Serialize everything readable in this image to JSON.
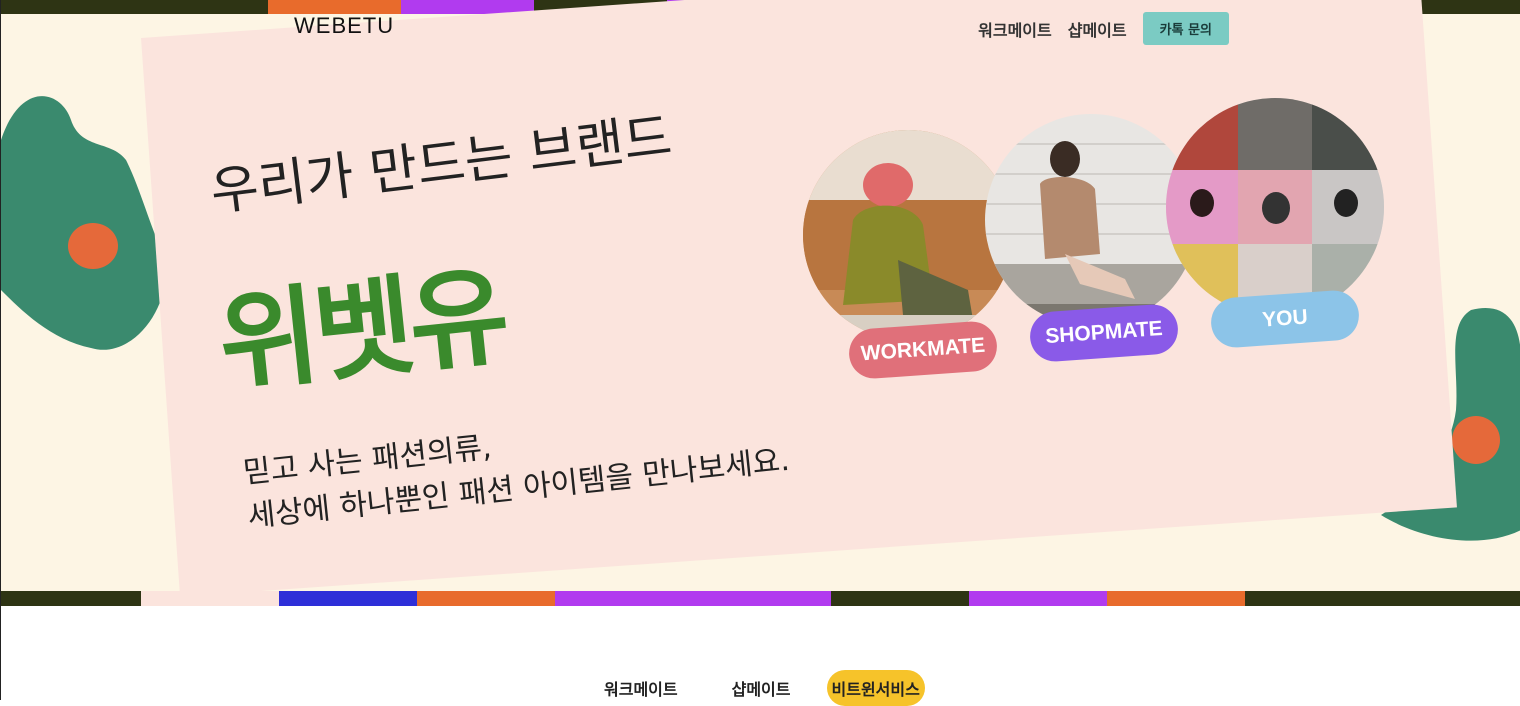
{
  "header": {
    "logo": "WEBETU",
    "nav": [
      {
        "label": "워크메이트"
      },
      {
        "label": "샵메이트"
      }
    ],
    "kakao_button": "카톡 문의"
  },
  "hero": {
    "headline": "우리가 만드는 브랜드",
    "brand_name": "위벳유",
    "tagline_line1": "믿고 사는 패션의류,",
    "tagline_line2": "세상에 하나뿐인 패션 아이템을 만나보세요.",
    "bubbles": [
      {
        "label": "WORKMATE",
        "color": "#e0707a"
      },
      {
        "label": "SHOPMATE",
        "color": "#8a5ae8"
      },
      {
        "label": "YOU",
        "color": "#8cc4e8"
      }
    ]
  },
  "tabs": [
    {
      "label": "워크메이트",
      "active": false
    },
    {
      "label": "샵메이트",
      "active": false
    },
    {
      "label": "비트윈서비스",
      "active": true
    }
  ],
  "colors": {
    "cream_bg": "#fdf5e4",
    "card_pink": "#fbe4dd",
    "brand_green": "#3a8a2c",
    "teal_blob": "#3a8a6e",
    "orange_dot": "#e5693a",
    "kakao_teal": "#7bcbc3",
    "tab_active": "#f6c32a"
  }
}
